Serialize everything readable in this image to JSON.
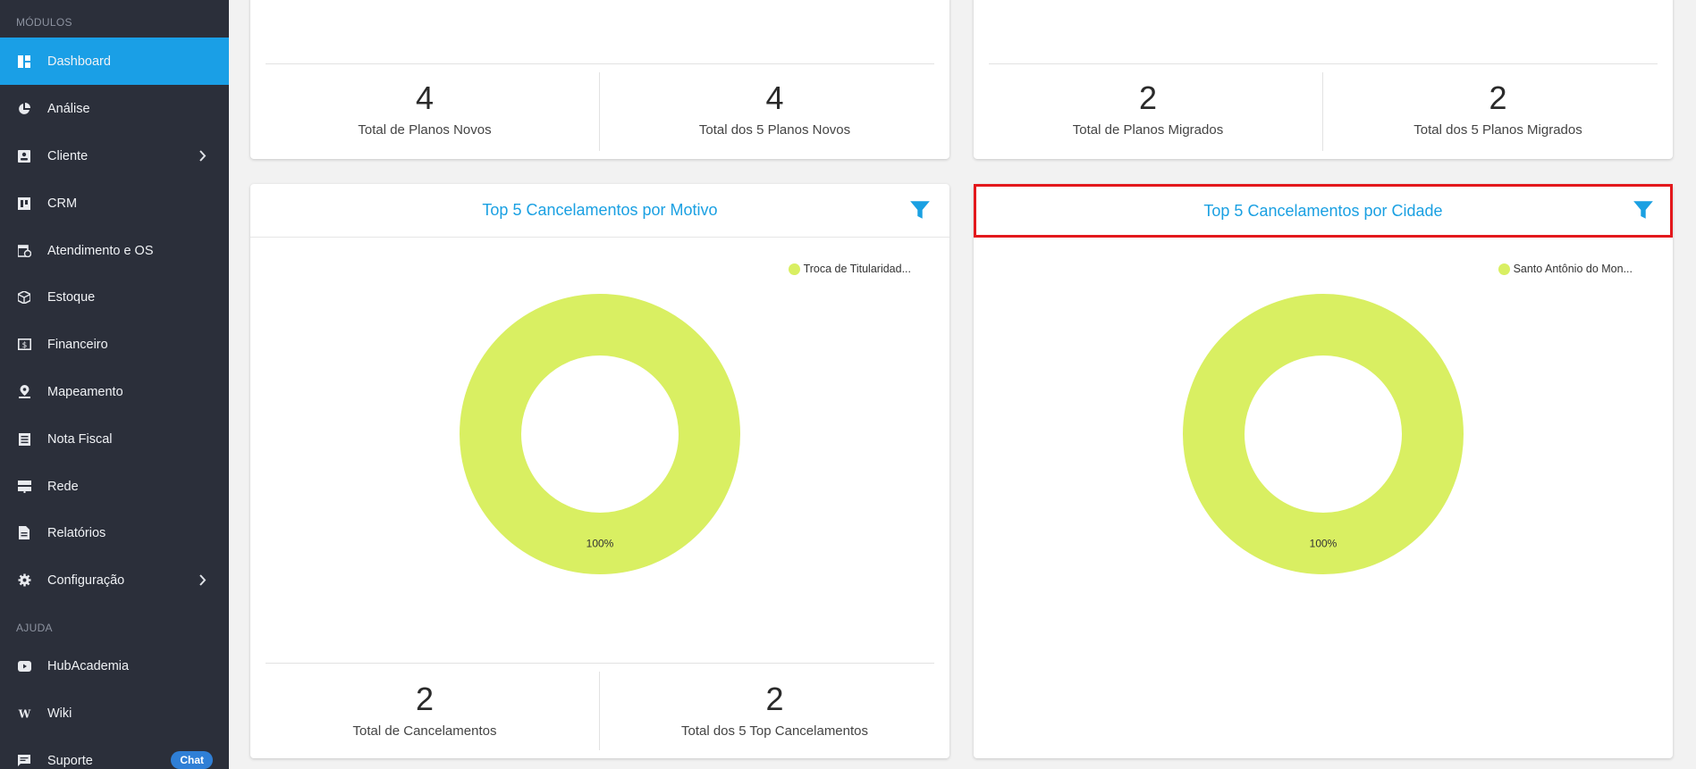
{
  "sidebar": {
    "modules_title": "MÓDULOS",
    "help_title": "AJUDA",
    "items": [
      {
        "label": "Dashboard"
      },
      {
        "label": "Análise"
      },
      {
        "label": "Cliente"
      },
      {
        "label": "CRM"
      },
      {
        "label": "Atendimento e OS"
      },
      {
        "label": "Estoque"
      },
      {
        "label": "Financeiro"
      },
      {
        "label": "Mapeamento"
      },
      {
        "label": "Nota Fiscal"
      },
      {
        "label": "Rede"
      },
      {
        "label": "Relatórios"
      },
      {
        "label": "Configuração"
      }
    ],
    "help_items": [
      {
        "label": "HubAcademia"
      },
      {
        "label": "Wiki"
      },
      {
        "label": "Suporte"
      }
    ],
    "chat_badge": "Chat"
  },
  "cards": {
    "planos_novos": {
      "stat1_value": "4",
      "stat1_label": "Total de Planos Novos",
      "stat2_value": "4",
      "stat2_label": "Total dos 5 Planos Novos"
    },
    "planos_migrados": {
      "stat1_value": "2",
      "stat1_label": "Total de Planos Migrados",
      "stat2_value": "2",
      "stat2_label": "Total dos 5 Planos Migrados"
    },
    "cancel_motivo": {
      "title": "Top 5 Cancelamentos por Motivo",
      "stat1_value": "2",
      "stat1_label": "Total de Cancelamentos",
      "stat2_value": "2",
      "stat2_label": "Total dos 5 Top Cancelamentos"
    },
    "cancel_cidade": {
      "title": "Top 5 Cancelamentos por Cidade"
    }
  },
  "colors": {
    "accent": "#1aa0e2",
    "sidebar_bg": "#2b2f3a",
    "active_bg": "#1a9fe6",
    "slice": "#d9ef62",
    "highlight": "#e3181c"
  },
  "chart_data": [
    {
      "type": "pie",
      "title": "Top 5 Cancelamentos por Motivo",
      "categories": [
        "Troca de Titularidad..."
      ],
      "values": [
        100
      ],
      "labels": [
        "100%"
      ],
      "legend": "top-right"
    },
    {
      "type": "pie",
      "title": "Top 5 Cancelamentos por Cidade",
      "categories": [
        "Santo Antônio do Mon..."
      ],
      "values": [
        100
      ],
      "labels": [
        "100%"
      ],
      "legend": "top-right"
    }
  ]
}
